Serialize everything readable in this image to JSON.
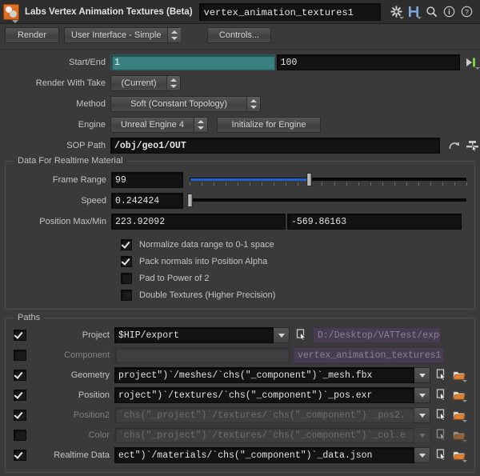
{
  "titlebar": {
    "node_icon": "vat-node-icon",
    "title": "Labs Vertex Animation Textures (Beta)",
    "node_name": "vertex_animation_textures1",
    "icons": [
      {
        "name": "gear-icon",
        "label": "gear"
      },
      {
        "name": "houdini-h-icon",
        "label": "H"
      },
      {
        "name": "search-icon",
        "label": "search"
      },
      {
        "name": "info-icon",
        "label": "info"
      },
      {
        "name": "help-icon",
        "label": "help"
      }
    ]
  },
  "toolbar": {
    "render_label": "Render",
    "interface_menu": "User Interface - Simple",
    "controls_label": "Controls..."
  },
  "params": {
    "start_end": {
      "label": "Start/End",
      "start": "1",
      "end": "100",
      "range_icon": "set-range-to-playbar-icon"
    },
    "render_with_take": {
      "label": "Render With Take",
      "value": "(Current)"
    },
    "method": {
      "label": "Method",
      "value": "Soft   (Constant Topology)"
    },
    "engine": {
      "label": "Engine",
      "value": "Unreal Engine 4",
      "init_button": "Initialize for Engine"
    },
    "sop_path": {
      "label": "SOP Path",
      "value": "/obj/geo1/OUT",
      "reload_icon": "reload-icon",
      "pick_icon": "node-picker-icon"
    }
  },
  "realtime_material": {
    "title": "Data For Realtime Material",
    "frame_range": {
      "label": "Frame Range",
      "value": "99",
      "slider_percent": 43,
      "fill_percent": 43,
      "tick_count": 23
    },
    "speed": {
      "label": "Speed",
      "value": "0.242424",
      "slider_percent": 0,
      "fill_percent": 0,
      "tick_count": 0
    },
    "position_max_min": {
      "label": "Position Max/Min",
      "max": "223.92092",
      "min": "-569.86163"
    },
    "options": [
      {
        "label": "Normalize data range to 0-1 space",
        "checked": true
      },
      {
        "label": "Pack normals into Position Alpha",
        "checked": true
      },
      {
        "label": "Pad to Power of 2",
        "checked": false
      },
      {
        "label": "Double Textures (Higher Precision)",
        "checked": false
      }
    ]
  },
  "paths": {
    "title": "Paths",
    "rows": [
      {
        "label": "Project",
        "checked": true,
        "value": "$HIP/export",
        "disabled": false,
        "has_combo": true,
        "has_pick": true,
        "has_folder": false,
        "expr": "D:/Desktop/VATTest/export",
        "pick_icon": "node-picker-icon"
      },
      {
        "label": "Component",
        "checked": false,
        "value": "",
        "disabled": true,
        "has_combo": false,
        "has_pick": false,
        "has_folder": false,
        "expr": "vertex_animation_textures1"
      },
      {
        "label": "Geometry",
        "checked": true,
        "value": "project\")`/meshes/`chs(\"_component\")`_mesh.fbx",
        "disabled": false,
        "has_combo": true,
        "has_pick": true,
        "has_folder": true,
        "expr": null,
        "pick_icon": "node-picker-icon",
        "folder_icon": "open-folder-icon"
      },
      {
        "label": "Position",
        "checked": true,
        "value": "roject\")`/textures/`chs(\"_component\")`_pos.exr",
        "disabled": false,
        "has_combo": true,
        "has_pick": true,
        "has_folder": true,
        "expr": null,
        "pick_icon": "node-picker-icon",
        "folder_icon": "open-folder-icon"
      },
      {
        "label": "Position2",
        "checked": true,
        "value": "`chs(\"_project\")`/textures/`chs(\"_component\")`_pos2.",
        "disabled": true,
        "has_combo": true,
        "has_pick": true,
        "has_folder": true,
        "expr": null,
        "pick_icon": "node-picker-icon",
        "folder_icon": "open-folder-icon"
      },
      {
        "label": "Color",
        "checked": false,
        "value": "`chs(\"_project\")`/textures/`chs(\"_component\")`_col.e",
        "disabled": true,
        "has_combo": true,
        "has_pick": true,
        "has_folder": true,
        "expr": null,
        "pick_icon": "node-picker-icon",
        "folder_icon": "open-folder-icon"
      },
      {
        "label": "Realtime Data",
        "checked": true,
        "value": "ect\")`/materials/`chs(\"_component\")`_data.json",
        "disabled": false,
        "has_combo": true,
        "has_pick": true,
        "has_folder": true,
        "expr": null,
        "pick_icon": "node-picker-icon",
        "folder_icon": "open-folder-icon"
      }
    ]
  },
  "colors": {
    "accent_teal": "#3b8080",
    "slider_blue": "#1f62d0",
    "expr_purple": "#463d50",
    "folder_orange": "#e08030",
    "window_bg": "#3a3a3a"
  }
}
